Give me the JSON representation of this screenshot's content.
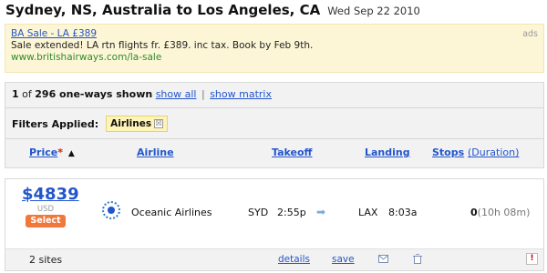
{
  "header": {
    "route": "Sydney, NS, Australia to Los Angeles, CA",
    "date": "Wed Sep 22 2010"
  },
  "ad": {
    "title": "BA Sale - LA £389",
    "description": "Sale extended! LA rtn flights fr. £389. inc tax. Book by Feb 9th.",
    "url": "www.britishairways.com/la-sale",
    "tag": "ads"
  },
  "summary": {
    "shown": "1",
    "of_text": "of",
    "total": "296 one-ways shown",
    "show_all": "show all",
    "separator": "|",
    "show_matrix": "show matrix"
  },
  "filters": {
    "label": "Filters Applied:",
    "chip": "Airlines",
    "chip_remove": "☒"
  },
  "columns": {
    "price": "Price",
    "price_star": "*",
    "sort_indicator": "▲",
    "airline": "Airline",
    "takeoff": "Takeoff",
    "landing": "Landing",
    "stops": "Stops",
    "duration": "(Duration)"
  },
  "result": {
    "price": "$4839",
    "currency": "USD",
    "select": "Select",
    "airline": "Oceanic Airlines",
    "from_code": "SYD",
    "takeoff_time": "2:55p",
    "arrow": "➡",
    "to_code": "LAX",
    "landing_time": "8:03a",
    "stops": "0",
    "duration": "(10h 08m)",
    "sites": "2 sites",
    "details": "details",
    "save": "save",
    "alert": "!"
  },
  "colors": {
    "link": "#2255cc",
    "ad_background": "#fdf6d6",
    "ad_url": "#2f8a2f",
    "select_button": "#f0783c",
    "chip_background": "#fff4b8"
  }
}
